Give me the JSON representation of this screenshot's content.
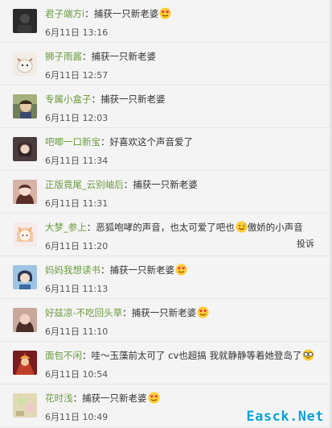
{
  "comments": [
    {
      "username": "君子端方i",
      "separator": "：",
      "text": "捕获一只新老婆",
      "emoji": "heart-eyes",
      "time": "6月11日 13:16",
      "avatar_color": "#2b2b2b"
    },
    {
      "username": "狮子雨酱",
      "separator": "：",
      "text": "捕获一只新老婆",
      "emoji": "",
      "time": "6月11日 12:57",
      "avatar_color": "#e8e0d4"
    },
    {
      "username": "专属小盒子",
      "separator": "：",
      "text": "捕获一只新老婆",
      "emoji": "",
      "time": "6月11日 12:03",
      "avatar_color": "#8a7a5c"
    },
    {
      "username": "吧唧一口新宝",
      "separator": "：",
      "text": "好喜欢这个声音爱了",
      "emoji": "",
      "time": "6月11日 11:34",
      "avatar_color": "#5b4a48"
    },
    {
      "username": "正版竟尾_云别岫后",
      "separator": "：",
      "text": "捕获一只新老婆",
      "emoji": "",
      "time": "6月11日 11:31",
      "avatar_color": "#c79b8f"
    },
    {
      "username": "大梦_参上",
      "separator": "：",
      "text": "恶狐咆哮的声音，也太可爱了吧也",
      "emoji": "smile-sweat",
      "text2": "傲娇的小声音",
      "time": "6月11日 11:20",
      "avatar_color": "#f3dede",
      "report": "投诉"
    },
    {
      "username": "妈妈我想读书",
      "separator": "：",
      "text": "捕获一只新老婆",
      "emoji": "heart-eyes",
      "time": "6月11日 11:13",
      "avatar_color": "#6c8fb5"
    },
    {
      "username": "好兹凉-不吃回头草",
      "separator": "：",
      "text": "捕获一只新老婆",
      "emoji": "heart-eyes",
      "time": "6月11日 11:10",
      "avatar_color": "#b08f80"
    },
    {
      "username": "面包不闲",
      "separator": "：",
      "text": "哇～玉藻前太可了 cv也超搞 我就静静等着她登岛了",
      "emoji": "glasses",
      "time": "6月11日 10:54",
      "avatar_color": "#a0262a"
    },
    {
      "username": "花时浅",
      "separator": "：",
      "text": "捕获一只新老婆",
      "emoji": "heart-eyes",
      "time": "6月11日 10:49",
      "avatar_color": "#d9cfa7"
    }
  ],
  "watermark": "Easck.Net"
}
